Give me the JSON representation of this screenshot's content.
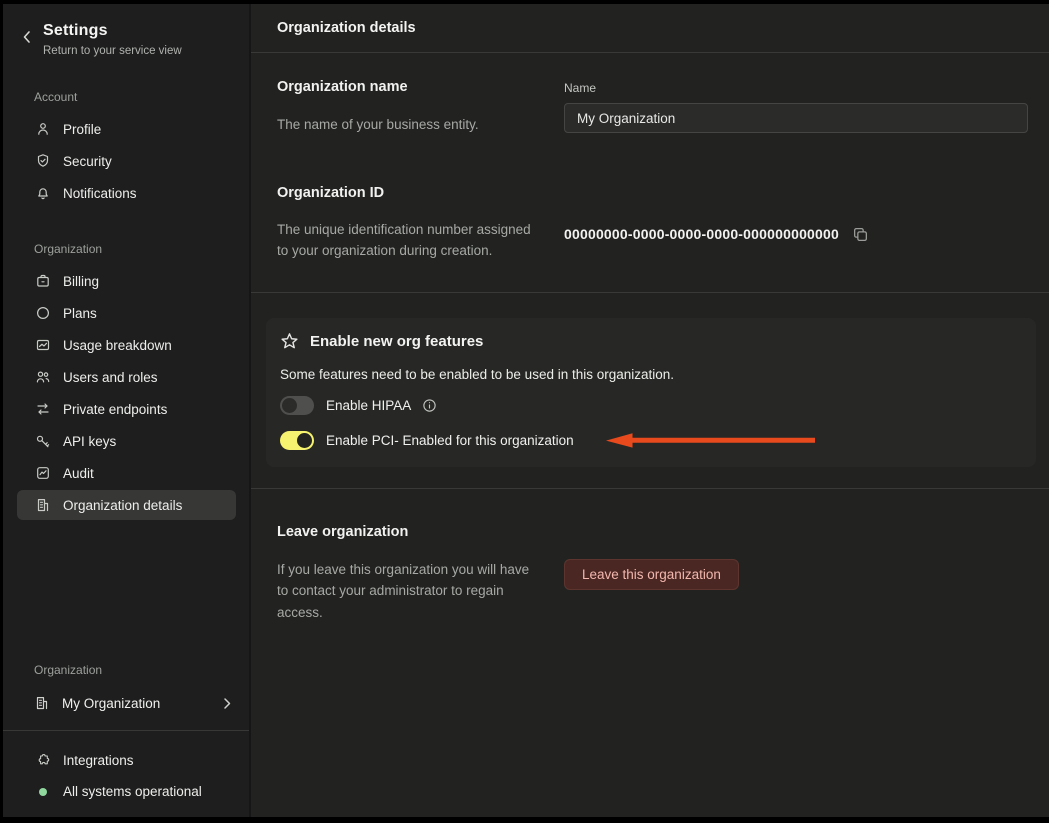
{
  "sidebar": {
    "title": "Settings",
    "subtitle": "Return to your service view",
    "account_section": {
      "label": "Account",
      "items": [
        {
          "icon": "person-icon",
          "label": "Profile"
        },
        {
          "icon": "shield-check-icon",
          "label": "Security"
        },
        {
          "icon": "bell-icon",
          "label": "Notifications"
        }
      ]
    },
    "organization_section": {
      "label": "Organization",
      "items": [
        {
          "icon": "billing-icon",
          "label": "Billing"
        },
        {
          "icon": "circle-icon",
          "label": "Plans"
        },
        {
          "icon": "usage-chart-icon",
          "label": "Usage breakdown"
        },
        {
          "icon": "users-icon",
          "label": "Users and roles"
        },
        {
          "icon": "swap-arrows-icon",
          "label": "Private endpoints"
        },
        {
          "icon": "key-icon",
          "label": "API keys"
        },
        {
          "icon": "audit-icon",
          "label": "Audit"
        },
        {
          "icon": "building-icon",
          "label": "Organization details",
          "selected": true
        }
      ]
    },
    "org_switcher": {
      "label": "Organization",
      "value": "My Organization"
    },
    "footer": {
      "integrations_label": "Integrations",
      "status_label": "All systems operational"
    }
  },
  "main": {
    "title": "Organization details",
    "org_name_section": {
      "heading": "Organization name",
      "description": "The name of your business entity.",
      "field_label": "Name",
      "field_value": "My Organization"
    },
    "org_id_section": {
      "heading": "Organization ID",
      "description": "The unique identification number assigned to your organization during creation.",
      "value": "00000000-0000-0000-0000-000000000000"
    },
    "features_card": {
      "title": "Enable new org features",
      "description": "Some features need to be enabled to be used in this organization.",
      "hipaa_toggle": {
        "label": "Enable HIPAA",
        "state": "off"
      },
      "pci_toggle": {
        "label": "Enable PCI- Enabled for this organization",
        "state": "on"
      }
    },
    "leave_section": {
      "heading": "Leave organization",
      "description": "If you leave this organization you will have to contact your administrator to regain access.",
      "button_label": "Leave this organization"
    }
  },
  "colors": {
    "toggle_on": "#f6f370",
    "arrow": "#e84a1e",
    "status_dot": "#8fd79d",
    "danger_button_bg": "#4b2723",
    "danger_button_text": "#f2b7ae"
  }
}
